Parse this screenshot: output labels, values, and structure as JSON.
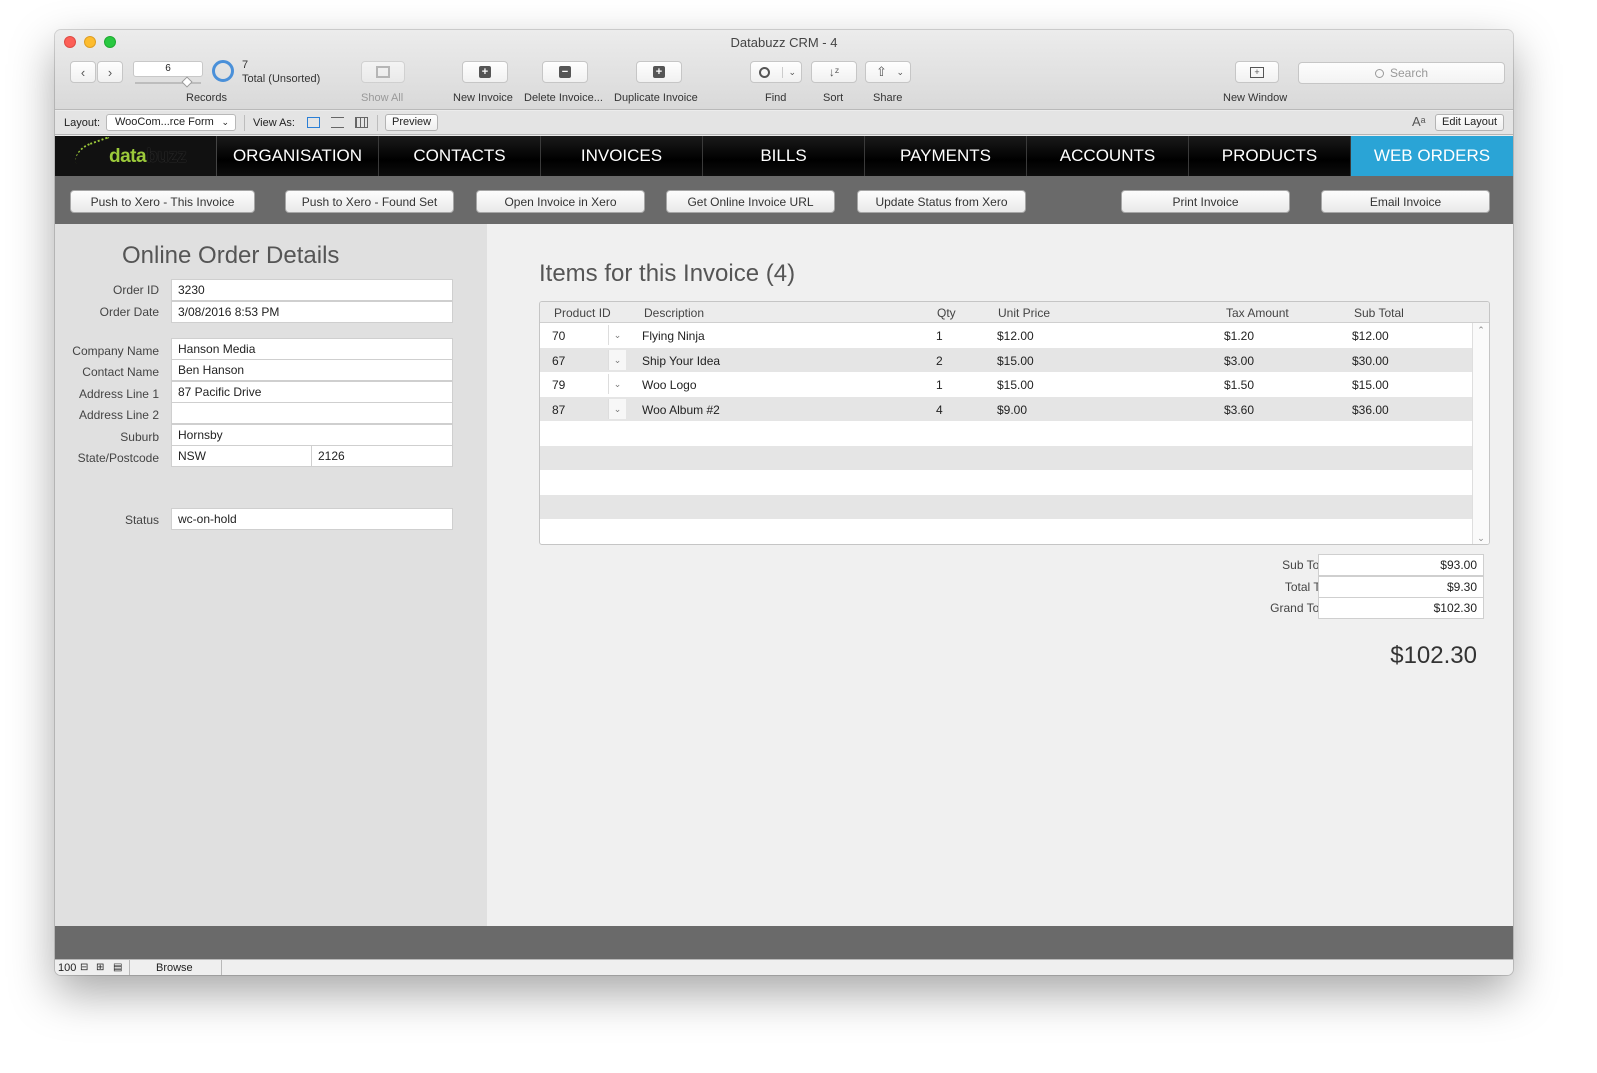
{
  "window": {
    "title": "Databuzz CRM - 4"
  },
  "toolbar": {
    "records_value": "6",
    "record_count": "7",
    "record_total": "Total (Unsorted)",
    "records_label": "Records",
    "show_all": "Show All",
    "new_invoice": "New Invoice",
    "delete_invoice": "Delete Invoice...",
    "duplicate_invoice": "Duplicate Invoice",
    "find": "Find",
    "sort": "Sort",
    "share": "Share",
    "new_window": "New Window",
    "search_placeholder": "Search"
  },
  "layout_bar": {
    "layout_label": "Layout:",
    "layout_value": "WooCom...rce Form",
    "view_as_label": "View As:",
    "preview": "Preview",
    "edit_layout": "Edit Layout"
  },
  "nav": {
    "logo_text_a": "data",
    "logo_text_b": "buzz",
    "items": [
      "ORGANISATION",
      "CONTACTS",
      "INVOICES",
      "BILLS",
      "PAYMENTS",
      "ACCOUNTS",
      "PRODUCTS",
      "WEB ORDERS"
    ],
    "active": "WEB ORDERS",
    "active_color": "#2aa4d6"
  },
  "actions": {
    "push_this": "Push to Xero - This Invoice",
    "push_found": "Push to Xero - Found Set",
    "open_xero": "Open Invoice in Xero",
    "get_url": "Get Online Invoice URL",
    "update_status": "Update Status from Xero",
    "print": "Print Invoice",
    "email": "Email Invoice"
  },
  "order": {
    "title": "Online Order Details",
    "labels": {
      "order_id": "Order ID",
      "order_date": "Order Date",
      "company": "Company Name",
      "contact": "Contact Name",
      "address1": "Address Line 1",
      "address2": "Address Line 2",
      "suburb": "Suburb",
      "state_postcode": "State/Postcode",
      "status": "Status"
    },
    "values": {
      "order_id": "3230",
      "order_date": "3/08/2016 8:53 PM",
      "company": "Hanson Media",
      "contact": "Ben Hanson",
      "address1": "87 Pacific Drive",
      "address2": "",
      "suburb": "Hornsby",
      "state": "NSW",
      "postcode": "2126",
      "status": "wc-on-hold"
    }
  },
  "items": {
    "title": "Items for this Invoice (4)",
    "columns": [
      "Product ID",
      "Description",
      "Qty",
      "Unit Price",
      "Tax Amount",
      "Sub Total"
    ],
    "rows": [
      {
        "pid": "70",
        "desc": "Flying Ninja",
        "qty": "1",
        "price": "$12.00",
        "tax": "$1.20",
        "sub": "$12.00"
      },
      {
        "pid": "67",
        "desc": "Ship Your Idea",
        "qty": "2",
        "price": "$15.00",
        "tax": "$3.00",
        "sub": "$30.00"
      },
      {
        "pid": "79",
        "desc": "Woo Logo",
        "qty": "1",
        "price": "$15.00",
        "tax": "$1.50",
        "sub": "$15.00"
      },
      {
        "pid": "87",
        "desc": "Woo Album #2",
        "qty": "4",
        "price": "$9.00",
        "tax": "$3.60",
        "sub": "$36.00"
      }
    ]
  },
  "totals": {
    "sub_total_label": "Sub Total",
    "sub_total": "$93.00",
    "total_tax_label": "Total Tax",
    "total_tax": "$9.30",
    "grand_total_label": "Grand Total",
    "grand_total": "$102.30",
    "big_total": "$102.30"
  },
  "status_bar": {
    "zoom": "100",
    "mode": "Browse"
  }
}
